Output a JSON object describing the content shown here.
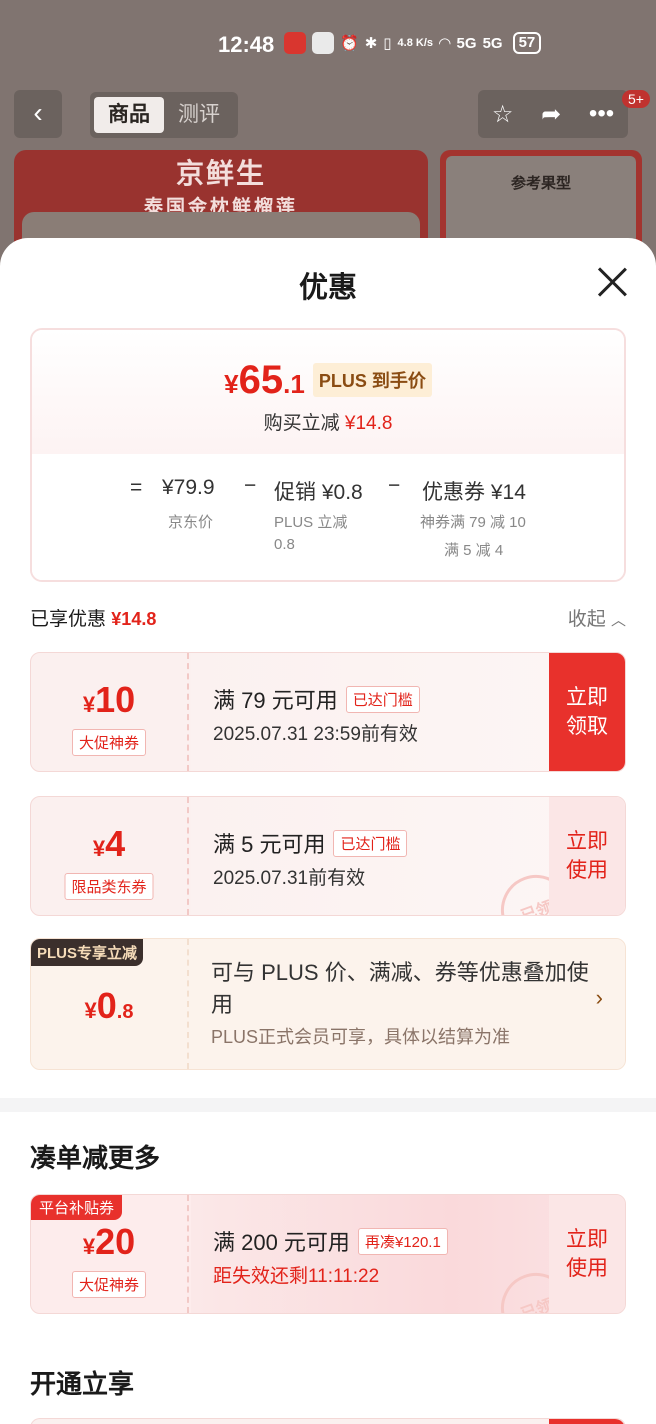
{
  "status_bar": {
    "time": "12:48",
    "net_speed": "4.8 K/s",
    "signal1": "5G",
    "signal2": "5G",
    "battery": "57"
  },
  "nav": {
    "back_icon": "‹",
    "tabs": [
      {
        "label": "商品",
        "active": true
      },
      {
        "label": "测评",
        "active": false
      }
    ],
    "badge": "5+"
  },
  "background_banner": {
    "brand": "京鲜生",
    "product": "泰国金枕鲜榴莲",
    "right_label": "参考果型"
  },
  "sheet": {
    "title": "优惠",
    "price": {
      "currency": "¥",
      "integer": "65",
      "decimal": ".1",
      "plus_tag": "PLUS 到手价",
      "sub_prefix": "购买立减",
      "sub_amount": "¥14.8"
    },
    "breakdown": {
      "eq": "=",
      "jd_price": "¥79.9",
      "jd_price_label": "京东价",
      "minus1": "−",
      "promo": "促销 ¥0.8",
      "promo_label": "PLUS 立减 0.8",
      "minus2": "−",
      "coupon": "优惠券 ¥14",
      "coupon_label_1": "神券满 79 减 10",
      "coupon_label_2": "满 5 减 4"
    },
    "enjoyed": {
      "label": "已享优惠",
      "amount": "¥14.8",
      "collapse": "收起"
    },
    "coupons": [
      {
        "yen": "¥",
        "amount": "10",
        "tag": "大促神券",
        "condition": "满 79 元可用",
        "status": "已达门槛",
        "valid": "2025.07.31 23:59前有效",
        "button": "立即领取"
      },
      {
        "yen": "¥",
        "amount": "4",
        "tag": "限品类东券",
        "condition": "满 5 元可用",
        "status": "已达门槛",
        "valid": "2025.07.31前有效",
        "button": "立即使用",
        "stamp": "已领"
      }
    ],
    "plus_card": {
      "corner": "PLUS专享立减",
      "yen": "¥",
      "amount": "0",
      "decimal": ".8",
      "title": "可与 PLUS 价、满减、券等优惠叠加使用",
      "desc": "PLUS正式会员可享，具体以结算为准"
    },
    "section_more": {
      "title": "凑单减更多",
      "coupon": {
        "corner": "平台补贴券",
        "yen": "¥",
        "amount": "20",
        "tag": "大促神券",
        "condition": "满 200 元可用",
        "status": "再凑¥120.1",
        "valid": "距失效还剩11:11:22",
        "button": "立即使用",
        "stamp": "已领"
      }
    },
    "section_open": {
      "title": "开通立享"
    }
  },
  "colors": {
    "accent": "#e2231a",
    "plus_brown": "#8a4c12"
  }
}
